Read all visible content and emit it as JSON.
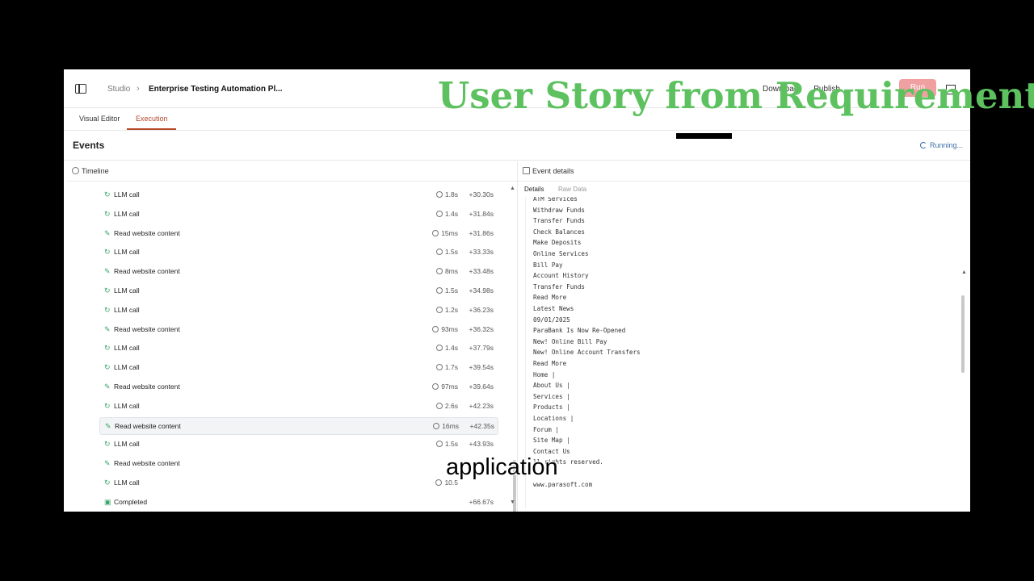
{
  "header": {
    "breadcrumb_root": "Studio",
    "breadcrumb_sep": "›",
    "breadcrumb_current": "Enterprise Testing Automation Pl...",
    "actions": [
      "Download",
      "Publish"
    ],
    "run_label": "Run"
  },
  "overlay_title": "User Story from Requirements",
  "tabs": [
    {
      "label": "Visual Editor",
      "active": false
    },
    {
      "label": "Execution",
      "active": true
    }
  ],
  "events": {
    "title": "Events",
    "status": "Running..."
  },
  "timeline": {
    "header": "Timeline",
    "rows": [
      {
        "type": "llm",
        "icon": "llm-icon",
        "label": "LLM call",
        "duration": "1.8s",
        "offset": "+30.30s",
        "selected": false
      },
      {
        "type": "llm",
        "icon": "llm-icon",
        "label": "LLM call",
        "duration": "1.4s",
        "offset": "+31.84s",
        "selected": false
      },
      {
        "type": "tool",
        "icon": "tool-icon",
        "label": "Read website content",
        "duration": "15ms",
        "offset": "+31.86s",
        "selected": false
      },
      {
        "type": "llm",
        "icon": "llm-icon",
        "label": "LLM call",
        "duration": "1.5s",
        "offset": "+33.33s",
        "selected": false
      },
      {
        "type": "tool",
        "icon": "tool-icon",
        "label": "Read website content",
        "duration": "8ms",
        "offset": "+33.48s",
        "selected": false
      },
      {
        "type": "llm",
        "icon": "llm-icon",
        "label": "LLM call",
        "duration": "1.5s",
        "offset": "+34.98s",
        "selected": false
      },
      {
        "type": "llm",
        "icon": "llm-icon",
        "label": "LLM call",
        "duration": "1.2s",
        "offset": "+36.23s",
        "selected": false
      },
      {
        "type": "tool",
        "icon": "tool-icon",
        "label": "Read website content",
        "duration": "93ms",
        "offset": "+36.32s",
        "selected": false
      },
      {
        "type": "llm",
        "icon": "llm-icon",
        "label": "LLM call",
        "duration": "1.4s",
        "offset": "+37.79s",
        "selected": false
      },
      {
        "type": "llm",
        "icon": "llm-icon",
        "label": "LLM call",
        "duration": "1.7s",
        "offset": "+39.54s",
        "selected": false
      },
      {
        "type": "tool",
        "icon": "tool-icon",
        "label": "Read website content",
        "duration": "97ms",
        "offset": "+39.64s",
        "selected": false
      },
      {
        "type": "llm",
        "icon": "llm-icon",
        "label": "LLM call",
        "duration": "2.6s",
        "offset": "+42.23s",
        "selected": false
      },
      {
        "type": "tool",
        "icon": "tool-icon",
        "label": "Read website content",
        "duration": "16ms",
        "offset": "+42.35s",
        "selected": true
      },
      {
        "type": "llm",
        "icon": "llm-icon",
        "label": "LLM call",
        "duration": "1.5s",
        "offset": "+43.93s",
        "selected": false
      },
      {
        "type": "tool",
        "icon": "tool-icon",
        "label": "Read website content",
        "duration": "",
        "offset": "",
        "selected": false
      },
      {
        "type": "llm",
        "icon": "llm-icon",
        "label": "LLM call",
        "duration": "10.5",
        "offset": "",
        "selected": false
      },
      {
        "type": "done",
        "icon": "completed-icon",
        "label": "Completed",
        "duration": "",
        "offset": "+66.67s",
        "selected": false
      }
    ]
  },
  "details": {
    "header": "Event details",
    "tabs": [
      {
        "label": "Details",
        "active": true
      },
      {
        "label": "Raw Data",
        "active": false
      }
    ],
    "lines": [
      "ATM Services",
      "Withdraw Funds",
      "Transfer Funds",
      "Check Balances",
      "Make Deposits",
      "Online Services",
      "Bill Pay",
      "Account History",
      "Transfer Funds",
      "Read More",
      "Latest News",
      "09/01/2025",
      "ParaBank Is Now Re-Opened",
      "New! Online Bill Pay",
      "New! Online Account Transfers",
      "Read More",
      "Home |",
      "About Us |",
      "Services |",
      "Products |",
      "Locations |",
      "Forum |",
      "Site Map |",
      "Contact Us",
      "ll rights reserved.",
      "",
      "www.parasoft.com"
    ]
  },
  "caption": "application"
}
